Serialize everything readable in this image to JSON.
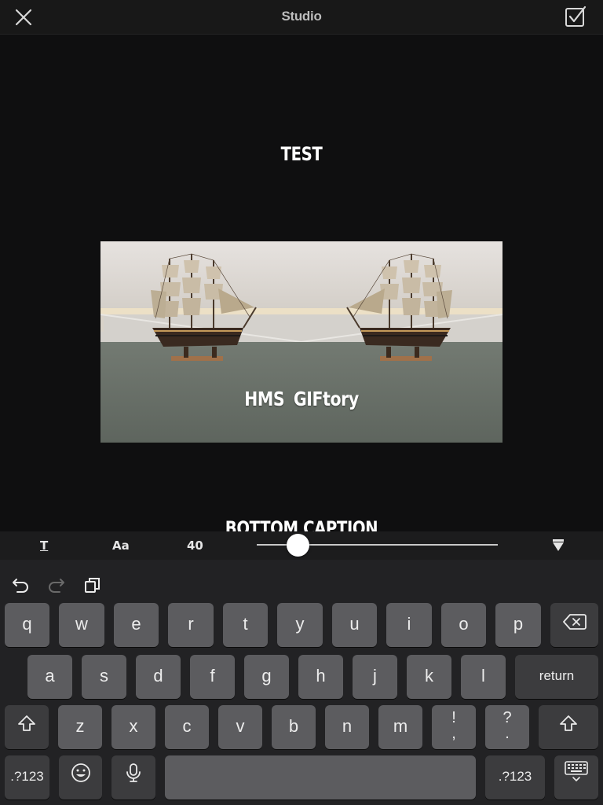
{
  "header": {
    "title": "Studio",
    "close_icon": "close-icon",
    "done_icon": "checkbox-checked-icon"
  },
  "canvas": {
    "top_caption": "TEST",
    "image_caption": "HMS GIFtory",
    "bottom_caption": "BOTTOM CAPTION"
  },
  "text_toolbar": {
    "text_style_label": "T",
    "font_label": "Aa",
    "font_size": "40",
    "size_slider_value": 0.17,
    "collapse_icon": "triangle-down-icon"
  },
  "keyboard": {
    "toolbar_icons": [
      "undo-icon",
      "redo-icon",
      "paste-icon"
    ],
    "row1": [
      "q",
      "w",
      "e",
      "r",
      "t",
      "y",
      "u",
      "i",
      "o",
      "p"
    ],
    "row2": [
      "a",
      "s",
      "d",
      "f",
      "g",
      "h",
      "j",
      "k",
      "l"
    ],
    "row3": [
      "z",
      "x",
      "c",
      "v",
      "b",
      "n",
      "m"
    ],
    "punct1": [
      "!",
      ","
    ],
    "punct2": [
      "?",
      "."
    ],
    "return_label": "return",
    "numbers_label": ".?123",
    "icons": [
      "backspace-icon",
      "shift-icon",
      "emoji-icon",
      "microphone-icon",
      "keyboard-dismiss-icon"
    ]
  },
  "colors": {
    "background": "#0f0f10",
    "keyboard_bg": "#222224",
    "key": "#5c5c5f",
    "key_dark": "#3c3c3e"
  }
}
